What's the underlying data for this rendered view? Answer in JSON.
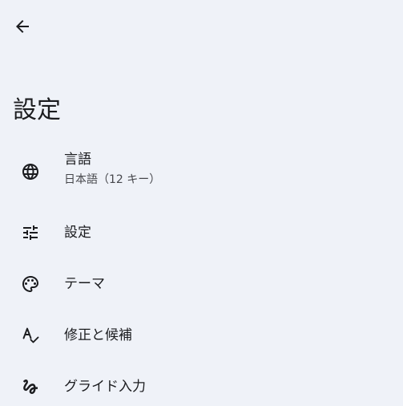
{
  "header": {
    "back_icon": "arrow-back-icon",
    "title": "設定"
  },
  "menu": {
    "items": [
      {
        "label": "言語",
        "sublabel": "日本語（12 キー）",
        "icon": "globe-icon"
      },
      {
        "label": "設定",
        "icon": "tune-sliders-icon"
      },
      {
        "label": "テーマ",
        "icon": "palette-icon"
      },
      {
        "label": "修正と候補",
        "icon": "spellcheck-icon"
      },
      {
        "label": "グライド入力",
        "icon": "gesture-icon"
      }
    ]
  },
  "colors": {
    "background": "#eff2f8",
    "text": "#1b1c1f",
    "subtext": "#46474c"
  }
}
